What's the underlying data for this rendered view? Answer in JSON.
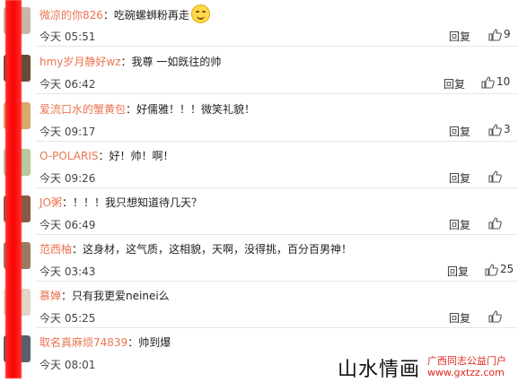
{
  "comments": [
    {
      "user": "微凉的你826",
      "sep": "：",
      "text": "吃碗螺蛳粉再走",
      "emoji": "smile-emoji",
      "time": "今天 05:51",
      "reply": "回复",
      "likes": "9",
      "avatar_color": "#c9b7a6"
    },
    {
      "user": "hmy岁月静好wz",
      "sep": "：",
      "text": "我尊 一如既往的帅",
      "emoji": "",
      "time": "今天 06:42",
      "reply": "回复",
      "likes": "10",
      "avatar_color": "#6a4b3a"
    },
    {
      "user": "爱流口水的蟹黄包",
      "sep": "：",
      "text": "好儒雅！！！微笑礼貌！",
      "emoji": "",
      "time": "今天 09:17",
      "reply": "回复",
      "likes": "3",
      "avatar_color": "#d9a86a"
    },
    {
      "user": "O-POLARIS",
      "sep": "：",
      "text": "好！帅！啊！",
      "emoji": "",
      "time": "今天 09:26",
      "reply": "回复",
      "likes": "",
      "avatar_color": "#b8c9a0"
    },
    {
      "user": "JO粥",
      "sep": "：",
      "text": "！！！我只想知道待几天？",
      "emoji": "",
      "time": "今天 06:49",
      "reply": "回复",
      "likes": "",
      "avatar_color": "#8a5a48"
    },
    {
      "user": "范西柚",
      "sep": "：",
      "text": "这身材，这气质，这相貌，天啊，没得挑，百分百男神！",
      "emoji": "",
      "time": "今天 03:43",
      "reply": "回复",
      "likes": "25",
      "avatar_color": "#9c7a62"
    },
    {
      "user": "慕婵",
      "sep": "：",
      "text": "只有我更爱neinei么",
      "emoji": "",
      "time": "今天 05:25",
      "reply": "回复",
      "likes": "",
      "avatar_color": "#e3d6c8"
    },
    {
      "user": "取名真麻烦74839",
      "sep": "：",
      "text": "帅到爆",
      "emoji": "",
      "time": "今天 08:01",
      "reply": "",
      "likes": "",
      "avatar_color": "#5a5f6a"
    }
  ],
  "watermark": {
    "main": "山水情画",
    "sub": "广西同志公益门户",
    "url": "www.gxtzz.com"
  },
  "colors": {
    "username": "#eb7350",
    "overlay_bar": "#ff0000"
  }
}
